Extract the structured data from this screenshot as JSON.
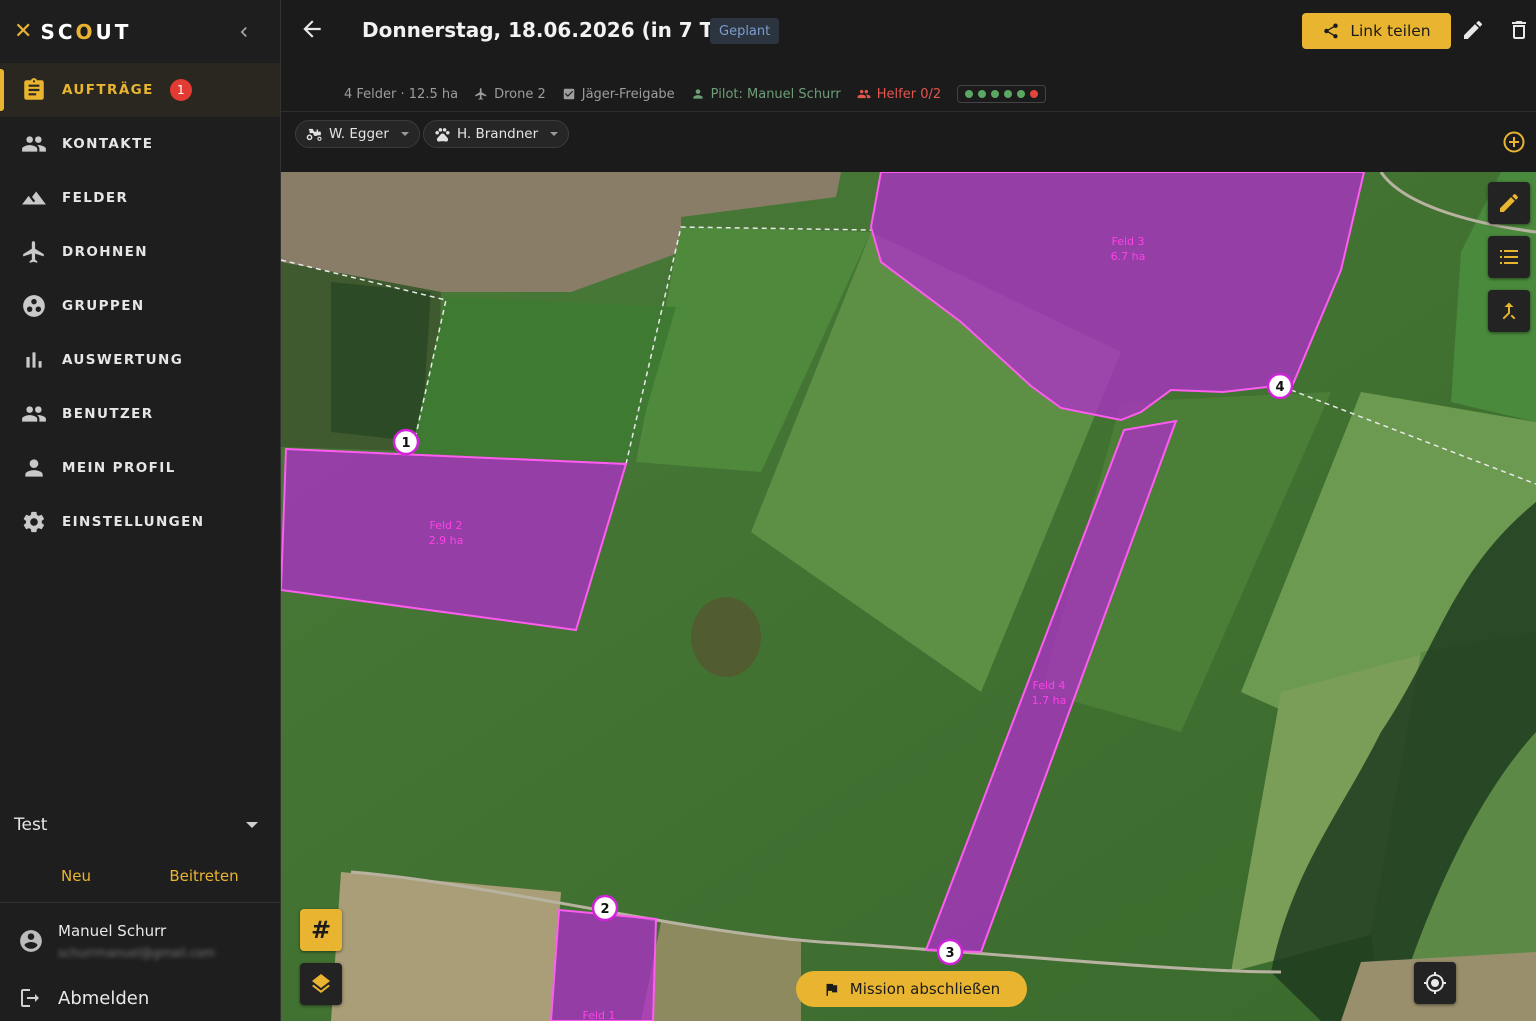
{
  "app": {
    "brand": "SCOUT"
  },
  "sidebar": {
    "items": [
      {
        "label": "AUFTRÄGE",
        "icon": "clipboard-icon",
        "badge": "1",
        "active": true
      },
      {
        "label": "KONTAKTE",
        "icon": "contacts-icon"
      },
      {
        "label": "FELDER",
        "icon": "terrain-icon"
      },
      {
        "label": "DROHNEN",
        "icon": "airplane-icon"
      },
      {
        "label": "GRUPPEN",
        "icon": "group-icon"
      },
      {
        "label": "AUSWERTUNG",
        "icon": "bar-chart-icon"
      },
      {
        "label": "BENUTZER",
        "icon": "users-icon"
      },
      {
        "label": "MEIN PROFIL",
        "icon": "person-icon"
      },
      {
        "label": "EINSTELLUNGEN",
        "icon": "gear-icon"
      }
    ],
    "group": {
      "selected": "Test",
      "new_label": "Neu",
      "join_label": "Beitreten"
    },
    "user": {
      "name": "Manuel Schurr",
      "email": "schurrmanuel@gmail.com"
    },
    "logout_label": "Abmelden"
  },
  "header": {
    "title": "Donnerstag, 18.06.2026 (in 7 Tagen)",
    "status": "Geplant",
    "share_label": "Link teilen",
    "meta": {
      "fields": "4 Felder · 12.5 ha",
      "drone": "Drone 2",
      "hunter": "Jäger-Freigabe",
      "pilot": "Pilot: Manuel Schurr",
      "helper": "Helfer 0/2"
    },
    "status_dots": [
      "green",
      "green",
      "green",
      "green",
      "green",
      "red"
    ],
    "chips": [
      {
        "label": "W. Egger",
        "icon": "tractor-icon"
      },
      {
        "label": "H. Brandner",
        "icon": "paw-icon"
      }
    ]
  },
  "map": {
    "fields": [
      {
        "name": "Feld 2",
        "area": "2.9 ha"
      },
      {
        "name": "Feld 3",
        "area": "6.7 ha"
      },
      {
        "name": "Feld 4",
        "area": "1.7 ha"
      },
      {
        "name": "Feld 1",
        "area": ""
      }
    ],
    "markers": [
      "1",
      "2",
      "3",
      "4"
    ],
    "finish_label": "Mission abschließen",
    "hash_label": "#"
  },
  "colors": {
    "accent": "#e9b531",
    "field_fill": "#b42ad2",
    "field_stroke": "#ff5cf0",
    "badge_red": "#e23b33",
    "pilot_green": "#6d9e78",
    "helper_red": "#e3564e"
  }
}
